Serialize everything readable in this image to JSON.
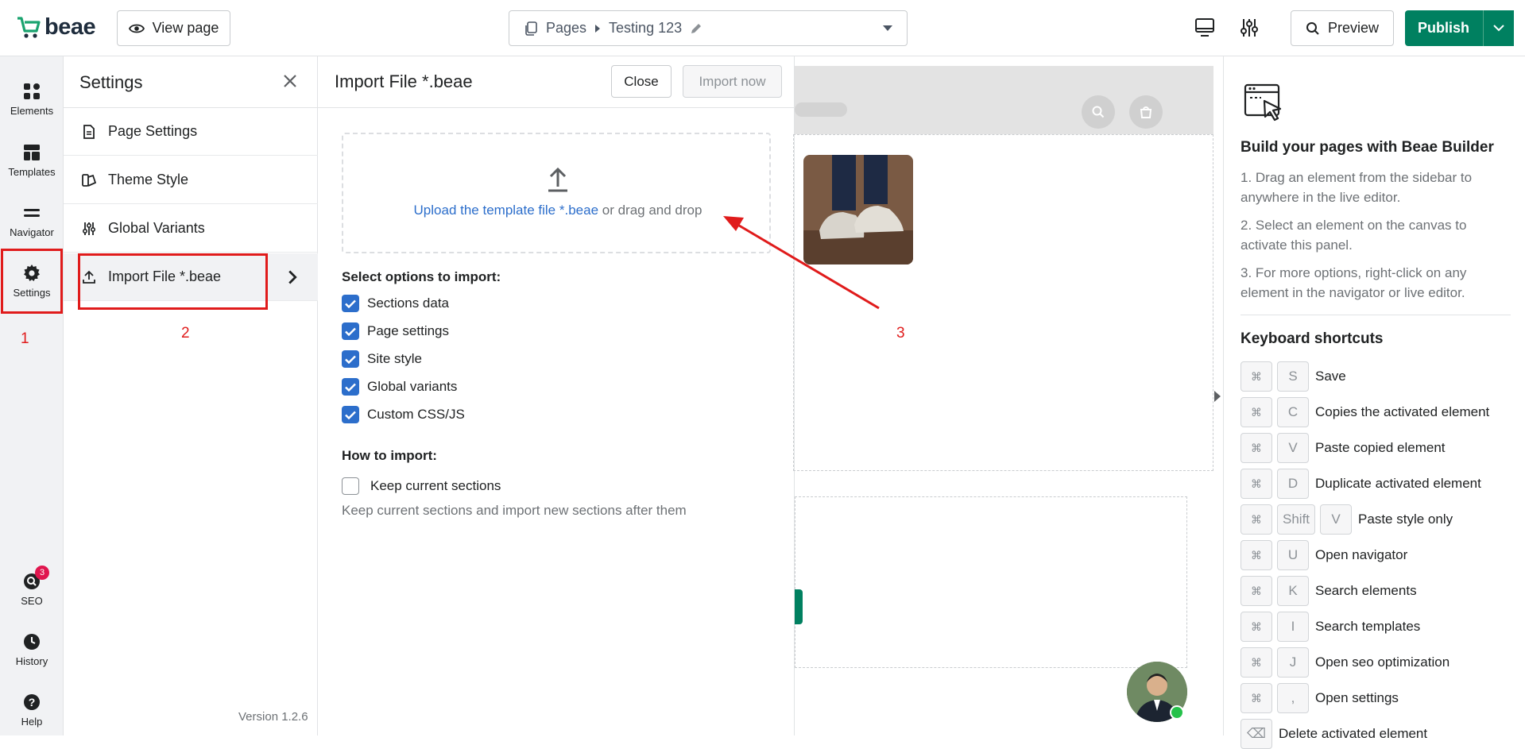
{
  "topbar": {
    "logo_text": "beae",
    "view_page_label": "View page",
    "breadcrumb_root": "Pages",
    "breadcrumb_page": "Testing 123",
    "preview_label": "Preview",
    "publish_label": "Publish"
  },
  "rail": {
    "elements": "Elements",
    "templates": "Templates",
    "navigator": "Navigator",
    "settings": "Settings",
    "seo": "SEO",
    "seo_badge": "3",
    "history": "History",
    "help": "Help"
  },
  "annotations": {
    "n1": "1",
    "n2": "2",
    "n3": "3"
  },
  "settings_panel": {
    "title": "Settings",
    "items": [
      {
        "label": "Page Settings"
      },
      {
        "label": "Theme Style"
      },
      {
        "label": "Global Variants"
      },
      {
        "label": "Import File *.beae"
      }
    ],
    "version": "Version 1.2.6"
  },
  "import_panel": {
    "title": "Import File *.beae",
    "close_label": "Close",
    "import_label": "Import now",
    "upload_link": "Upload the template file *.beae",
    "upload_rest": " or drag and drop",
    "select_label": "Select options to import:",
    "options": [
      {
        "label": "Sections data",
        "checked": true
      },
      {
        "label": "Page settings",
        "checked": true
      },
      {
        "label": "Site style",
        "checked": true
      },
      {
        "label": "Global variants",
        "checked": true
      },
      {
        "label": "Custom CSS/JS",
        "checked": true
      }
    ],
    "how_label": "How to import:",
    "keep_label": "Keep current sections",
    "keep_checked": false,
    "keep_hint": "Keep current sections and import new sections after them"
  },
  "right_panel": {
    "title": "Build your pages with Beae Builder",
    "steps": [
      "1. Drag an element from the sidebar to anywhere in the live editor.",
      "2. Select an element on the canvas to activate this panel.",
      "3. For more options, right-click on any element in the navigator or live editor."
    ],
    "shortcuts_title": "Keyboard shortcuts",
    "shortcuts": [
      {
        "keys": [
          "⌘",
          "S"
        ],
        "label": "Save"
      },
      {
        "keys": [
          "⌘",
          "C"
        ],
        "label": "Copies the activated element"
      },
      {
        "keys": [
          "⌘",
          "V"
        ],
        "label": "Paste copied element"
      },
      {
        "keys": [
          "⌘",
          "D"
        ],
        "label": "Duplicate activated element"
      },
      {
        "keys": [
          "⌘",
          "Shift",
          "V"
        ],
        "label": "Paste style only"
      },
      {
        "keys": [
          "⌘",
          "U"
        ],
        "label": "Open navigator"
      },
      {
        "keys": [
          "⌘",
          "K"
        ],
        "label": "Search elements"
      },
      {
        "keys": [
          "⌘",
          "I"
        ],
        "label": "Search templates"
      },
      {
        "keys": [
          "⌘",
          "J"
        ],
        "label": "Open seo optimization"
      },
      {
        "keys": [
          "⌘",
          ","
        ],
        "label": "Open settings"
      },
      {
        "keys": [
          "⌫"
        ],
        "label": "Delete activated element"
      }
    ]
  },
  "colors": {
    "brand_green": "#008060",
    "link_blue": "#2c6ecb",
    "annotation_red": "#e01b1b"
  }
}
